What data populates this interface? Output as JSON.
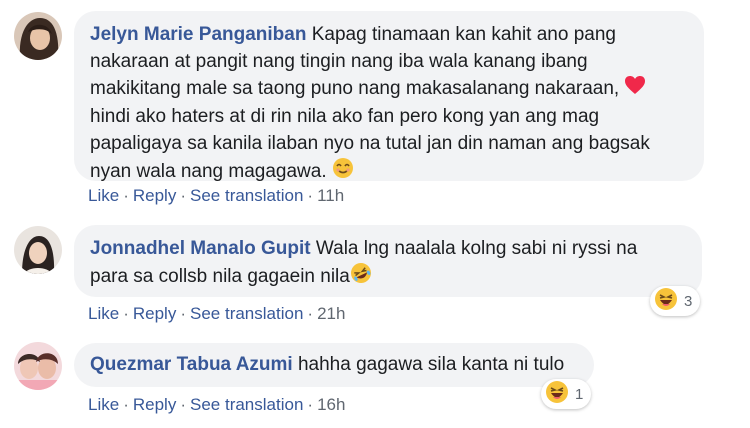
{
  "colors": {
    "link": "#385898",
    "bubble": "#f2f3f5",
    "meta": "#606770"
  },
  "comments": [
    {
      "author": "Jelyn Marie Panganiban",
      "lines": [
        "Kapag tinamaan kan kahit ano pang",
        "nakaraan at pangit nang tingin nang iba wala kanang ibang",
        "makikitang male sa taong puno nang makasalanang nakaraan,",
        "hindi ako haters at di rin nila ako fan pero kong yan ang mag",
        "papaligaya sa kanila ilaban nyo na tutal jan din naman ang bagsak",
        "nyan wala nang magagawa."
      ],
      "like": "Like",
      "reply": "Reply",
      "translate": "See translation",
      "time": "11h",
      "inline_emojis": [
        "heart-emoji",
        "smile-emoji"
      ]
    },
    {
      "author": "Jonnadhel Manalo Gupit",
      "lines": [
        "Wala lng naalala kolng sabi ni ryssi na",
        "para sa collsb nila gagaein nila"
      ],
      "like": "Like",
      "reply": "Reply",
      "translate": "See translation",
      "time": "21h",
      "inline_emojis": [
        "rofl-emoji"
      ],
      "reaction_count": "3",
      "reaction_icon": "haha-reaction-icon"
    },
    {
      "author": "Quezmar Tabua Azumi",
      "lines": [
        "hahha gagawa sila kanta ni tulo"
      ],
      "like": "Like",
      "reply": "Reply",
      "translate": "See translation",
      "time": "16h",
      "reaction_count": "1",
      "reaction_icon": "haha-reaction-icon"
    }
  ]
}
